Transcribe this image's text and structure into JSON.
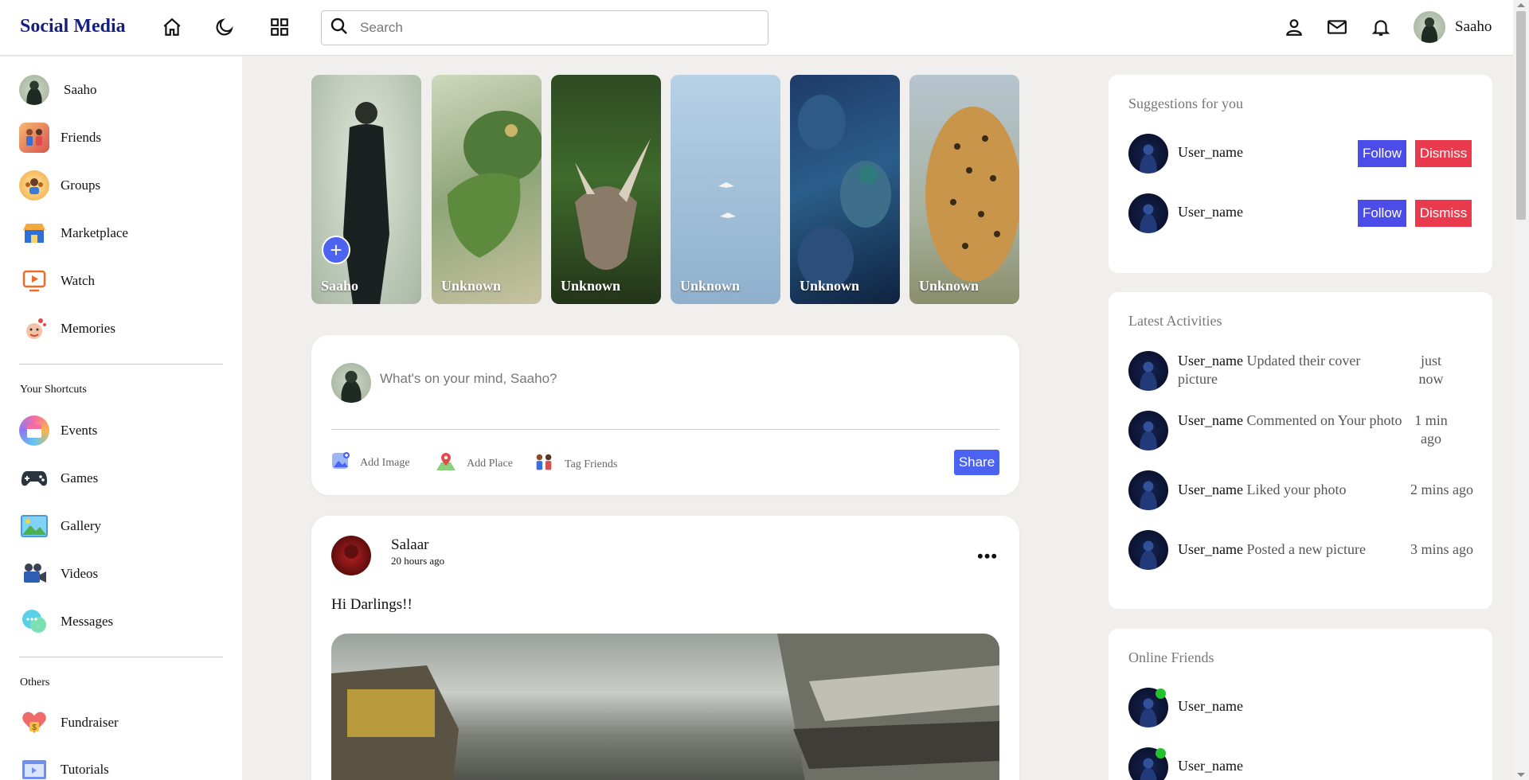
{
  "navbar": {
    "logo": "Social Media",
    "search_placeholder": "Search",
    "user_name": "Saaho",
    "icons": [
      "home-icon",
      "moon-icon",
      "grid-icon",
      "person-icon",
      "mail-icon",
      "bell-icon"
    ]
  },
  "sidebar": {
    "profile": "Saaho",
    "main_items": [
      {
        "label": "Friends",
        "icon": "friends-icon"
      },
      {
        "label": "Groups",
        "icon": "groups-icon"
      },
      {
        "label": "Marketplace",
        "icon": "marketplace-icon"
      },
      {
        "label": "Watch",
        "icon": "watch-icon"
      },
      {
        "label": "Memories",
        "icon": "memories-icon"
      }
    ],
    "shortcuts_title": "Your Shortcuts",
    "shortcuts": [
      {
        "label": "Events",
        "icon": "events-icon"
      },
      {
        "label": "Games",
        "icon": "gamepad-icon"
      },
      {
        "label": "Gallery",
        "icon": "gallery-icon"
      },
      {
        "label": "Videos",
        "icon": "video-camera-icon"
      },
      {
        "label": "Messages",
        "icon": "messages-icon"
      }
    ],
    "others_title": "Others",
    "others": [
      {
        "label": "Fundraiser",
        "icon": "fundraiser-icon"
      },
      {
        "label": "Tutorials",
        "icon": "tutorials-icon"
      }
    ]
  },
  "stories": [
    {
      "name": "Saaho"
    },
    {
      "name": "Unknown"
    },
    {
      "name": "Unknown"
    },
    {
      "name": "Unknown"
    },
    {
      "name": "Unknown"
    },
    {
      "name": "Unknown"
    }
  ],
  "composer": {
    "placeholder": "What's on your mind, Saaho?",
    "add_image": "Add Image",
    "add_place": "Add Place",
    "tag_friends": "Tag Friends",
    "share": "Share"
  },
  "post": {
    "author": "Salaar",
    "time": "20 hours ago",
    "text": "Hi Darlings!!",
    "more": "•••"
  },
  "suggestions": {
    "title": "Suggestions for you",
    "items": [
      {
        "name": "User_name",
        "follow": "Follow",
        "dismiss": "Dismiss"
      },
      {
        "name": "User_name",
        "follow": "Follow",
        "dismiss": "Dismiss"
      }
    ]
  },
  "activities": {
    "title": "Latest Activities",
    "items": [
      {
        "user": "User_name",
        "action": "Updated their cover picture",
        "time": "just now"
      },
      {
        "user": "User_name",
        "action": "Commented on Your photo",
        "time": "1 min ago"
      },
      {
        "user": "User_name",
        "action": "Liked your photo",
        "time": "2 mins ago"
      },
      {
        "user": "User_name",
        "action": "Posted a new picture",
        "time": "3 mins ago"
      }
    ]
  },
  "online": {
    "title": "Online Friends",
    "items": [
      {
        "name": "User_name"
      },
      {
        "name": "User_name"
      }
    ]
  },
  "colors": {
    "logo": "#131f85",
    "accent": "#4c62f0",
    "follow": "#4c4ce8",
    "dismiss": "#ea3b4e",
    "online": "#22c22e"
  }
}
